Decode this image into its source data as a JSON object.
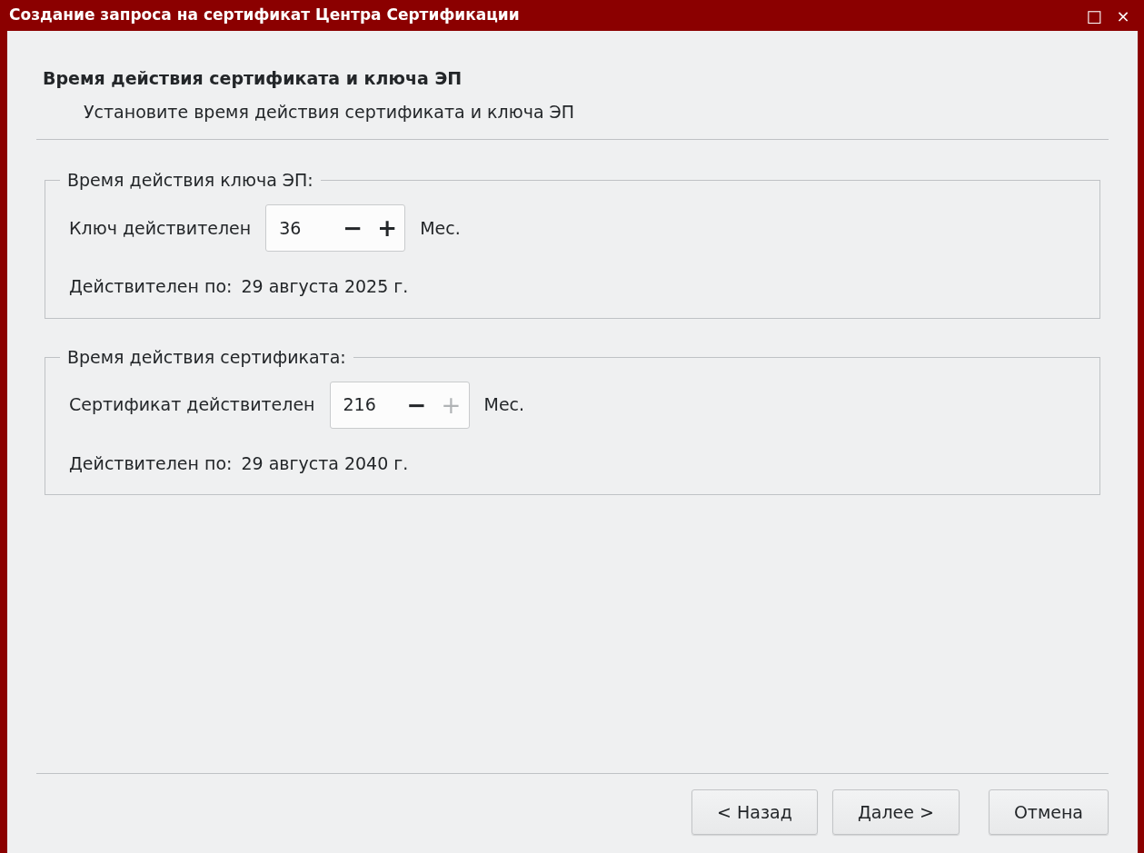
{
  "window": {
    "title": "Создание запроса на сертификат Центра Сертификации",
    "controls": [
      "□",
      "×"
    ]
  },
  "header": {
    "title": "Время действия сертификата и ключа ЭП",
    "subtitle": "Установите время действия сертификата и ключа ЭП"
  },
  "groups": [
    {
      "title": "Время действия ключа ЭП:",
      "label": "Ключ действителен",
      "value": "36",
      "minus": "−",
      "plus": "+",
      "minus_disabled": false,
      "plus_disabled": false,
      "unit": "Мес.",
      "valid_label": "Действителен по:",
      "valid_date": "29 августа 2025 г."
    },
    {
      "title": "Время действия сертификата:",
      "label": "Сертификат действителен",
      "value": "216",
      "minus": "−",
      "plus": "+",
      "minus_disabled": false,
      "plus_disabled": true,
      "unit": "Мес.",
      "valid_label": "Действителен по:",
      "valid_date": "29 августа 2040 г."
    }
  ],
  "buttons": [
    "< Назад",
    "Далее >",
    "Отмена"
  ]
}
